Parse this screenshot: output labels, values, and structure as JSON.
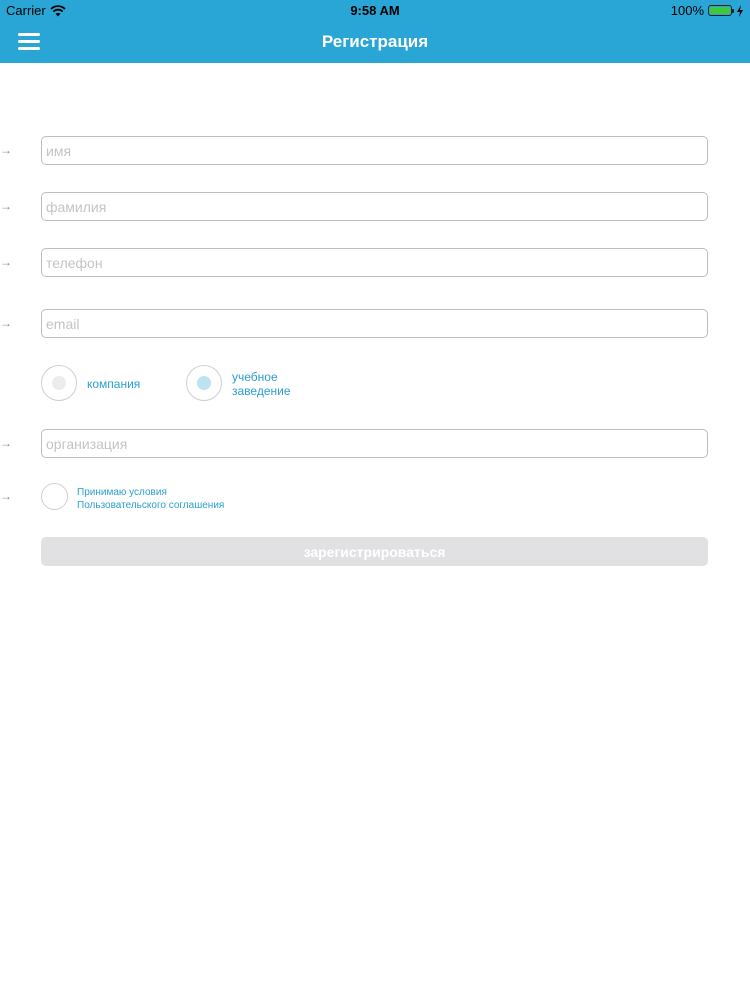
{
  "status_bar": {
    "carrier": "Carrier",
    "time": "9:58 AM",
    "battery": "100%"
  },
  "nav": {
    "title": "Регистрация",
    "menu_icon": "hamburger-menu-icon",
    "color": "#29a6d5"
  },
  "form": {
    "first_name": {
      "placeholder": "имя",
      "value": ""
    },
    "last_name": {
      "placeholder": "фамилия",
      "value": ""
    },
    "phone": {
      "placeholder": "телефон",
      "value": ""
    },
    "email": {
      "placeholder": "email",
      "value": ""
    },
    "organization": {
      "placeholder": "организация",
      "value": ""
    },
    "account_type": {
      "company_label": "компания",
      "institution_label_line1": "учебное",
      "institution_label_line2": "заведение",
      "selected": "учебное заведение"
    },
    "terms": {
      "line1": "Принимаю условия",
      "line2": "Пользовательского соглашения",
      "checked": false
    },
    "submit_label": "зарегистрироваться",
    "submit_enabled": false
  },
  "colors": {
    "accent": "#29a6d5",
    "link_text": "#2a9fcf",
    "disabled_button": "#e1e1e3"
  }
}
